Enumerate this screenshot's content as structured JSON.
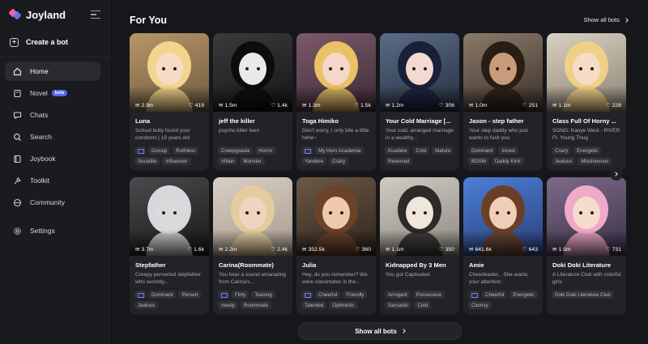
{
  "app": {
    "name": "Joyland"
  },
  "sidebar": {
    "create_label": "Create a bot",
    "items": [
      {
        "label": "Home",
        "icon": "home-icon",
        "active": true
      },
      {
        "label": "Novel",
        "icon": "book-icon",
        "badge": "beta"
      },
      {
        "label": "Chats",
        "icon": "chat-icon"
      },
      {
        "label": "Search",
        "icon": "search-icon"
      },
      {
        "label": "Joybook",
        "icon": "joybook-icon"
      },
      {
        "label": "Toolkit",
        "icon": "toolkit-icon"
      },
      {
        "label": "Community",
        "icon": "community-icon"
      },
      {
        "label": "Settings",
        "icon": "gear-icon"
      }
    ]
  },
  "section": {
    "title": "For You",
    "show_all": "Show all bots",
    "show_all_bottom": "Show all bots"
  },
  "cards": [
    {
      "name": "Luna",
      "desc": "School bully found your condoms | 19 years old",
      "chats": "2.9m",
      "likes": "419",
      "tags": [
        "Gossip",
        "Ruthless",
        "Socialite",
        "Influencer"
      ],
      "icon_tag": true,
      "art": "blonde"
    },
    {
      "name": "jeff the killer",
      "desc": "psycho killer teen",
      "chats": "1.5m",
      "likes": "1.4k",
      "tags": [
        "Creepypasta",
        "Horror",
        "Villain",
        "Monster"
      ],
      "icon_tag": false,
      "art": "dark"
    },
    {
      "name": "Toga Himiko",
      "desc": "Don't worry, I only bite a little hehe~",
      "chats": "1.3m",
      "likes": "1.5k",
      "tags": [
        "My Hero Academia",
        "Yandere",
        "Crazy"
      ],
      "icon_tag": true,
      "art": "toga"
    },
    {
      "name": "Your Cold Marriage [...",
      "desc": "Your cold, arranged marriage in a wealthy...",
      "chats": "1.2m",
      "likes": "306",
      "tags": [
        "Kuudere",
        "Cold",
        "Mature",
        "Reserved"
      ],
      "icon_tag": false,
      "art": "navy"
    },
    {
      "name": "Jason - step father",
      "desc": "Your step daddy who just wants to fuck you",
      "chats": "1.0m",
      "likes": "251",
      "tags": [
        "Dominant",
        "Incest",
        "BDSM",
        "Daddy Kink"
      ],
      "icon_tag": false,
      "art": "jason"
    },
    {
      "name": "Class Full Of Horny ...",
      "desc": "SONG: Kanye West - RIVER Ft. Young Thug",
      "chats": "1.1m",
      "likes": "228",
      "tags": [
        "Crazy",
        "Energetic",
        "Jealous",
        "Mischievous"
      ],
      "icon_tag": false,
      "art": "class"
    },
    {
      "name": "Stepfather",
      "desc": "Creepy perverted stepfather who secretly...",
      "chats": "3.7m",
      "likes": "1.6k",
      "tags": [
        "Dominant",
        "Pervert",
        "Jealous"
      ],
      "icon_tag": true,
      "art": "silver"
    },
    {
      "name": "Carina(Roommate)",
      "desc": "You hear a sound emanating from Carina's...",
      "chats": "2.2m",
      "likes": "2.4k",
      "tags": [
        "Flirty",
        "Teasing",
        "needy",
        "Roommate"
      ],
      "icon_tag": true,
      "art": "carina"
    },
    {
      "name": "Julia",
      "desc": "Hey, do you remember? We were classmates in the...",
      "chats": "352.5k",
      "likes": "360",
      "tags": [
        "Cheerful",
        "Friendly",
        "Talented",
        "Optimistic"
      ],
      "icon_tag": true,
      "art": "julia"
    },
    {
      "name": "Kidnapped By 3 Men",
      "desc": "You got Captivated",
      "chats": "1.1m",
      "likes": "350",
      "tags": [
        "Arrogant",
        "Possessive",
        "Sarcastic",
        "Cold"
      ],
      "icon_tag": false,
      "art": "sketch"
    },
    {
      "name": "Amie",
      "desc": "Cheerleader、She wants your attention.",
      "chats": "641.6k",
      "likes": "643",
      "tags": [
        "Cheerful",
        "Energetic",
        "Clumsy"
      ],
      "icon_tag": true,
      "art": "amie"
    },
    {
      "name": "Doki Doki Literature",
      "desc": "A Literature Club with colorful girls",
      "chats": "1.5m",
      "likes": "731",
      "tags": [
        "Doki Doki Literature Club"
      ],
      "icon_tag": false,
      "art": "doki"
    }
  ]
}
